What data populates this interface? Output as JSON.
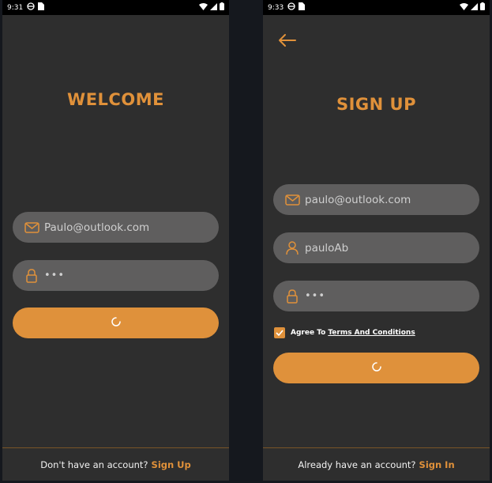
{
  "left": {
    "status_time": "9:31",
    "title": "WELCOME",
    "email_value": "Paulo@outlook.com",
    "password_value": "•••",
    "footer_text": "Don't have an account?",
    "footer_link": "Sign Up"
  },
  "right": {
    "status_time": "9:33",
    "title": "SIGN UP",
    "email_value": "paulo@outlook.com",
    "username_value": "pauloAb",
    "password_value": "•••",
    "agree_text": "Agree To",
    "terms_link": "Terms And Conditions",
    "agree_checked": true,
    "footer_text": "Already have an account?",
    "footer_link": "Sign In"
  },
  "colors": {
    "accent": "#df913b",
    "screen_bg": "#2e2e2e",
    "field_bg": "#5f5e5e"
  },
  "icons": {
    "email": "envelope-icon",
    "username": "person-icon",
    "password": "lock-icon",
    "back": "arrow-left-icon",
    "loading": "spinner-icon"
  }
}
